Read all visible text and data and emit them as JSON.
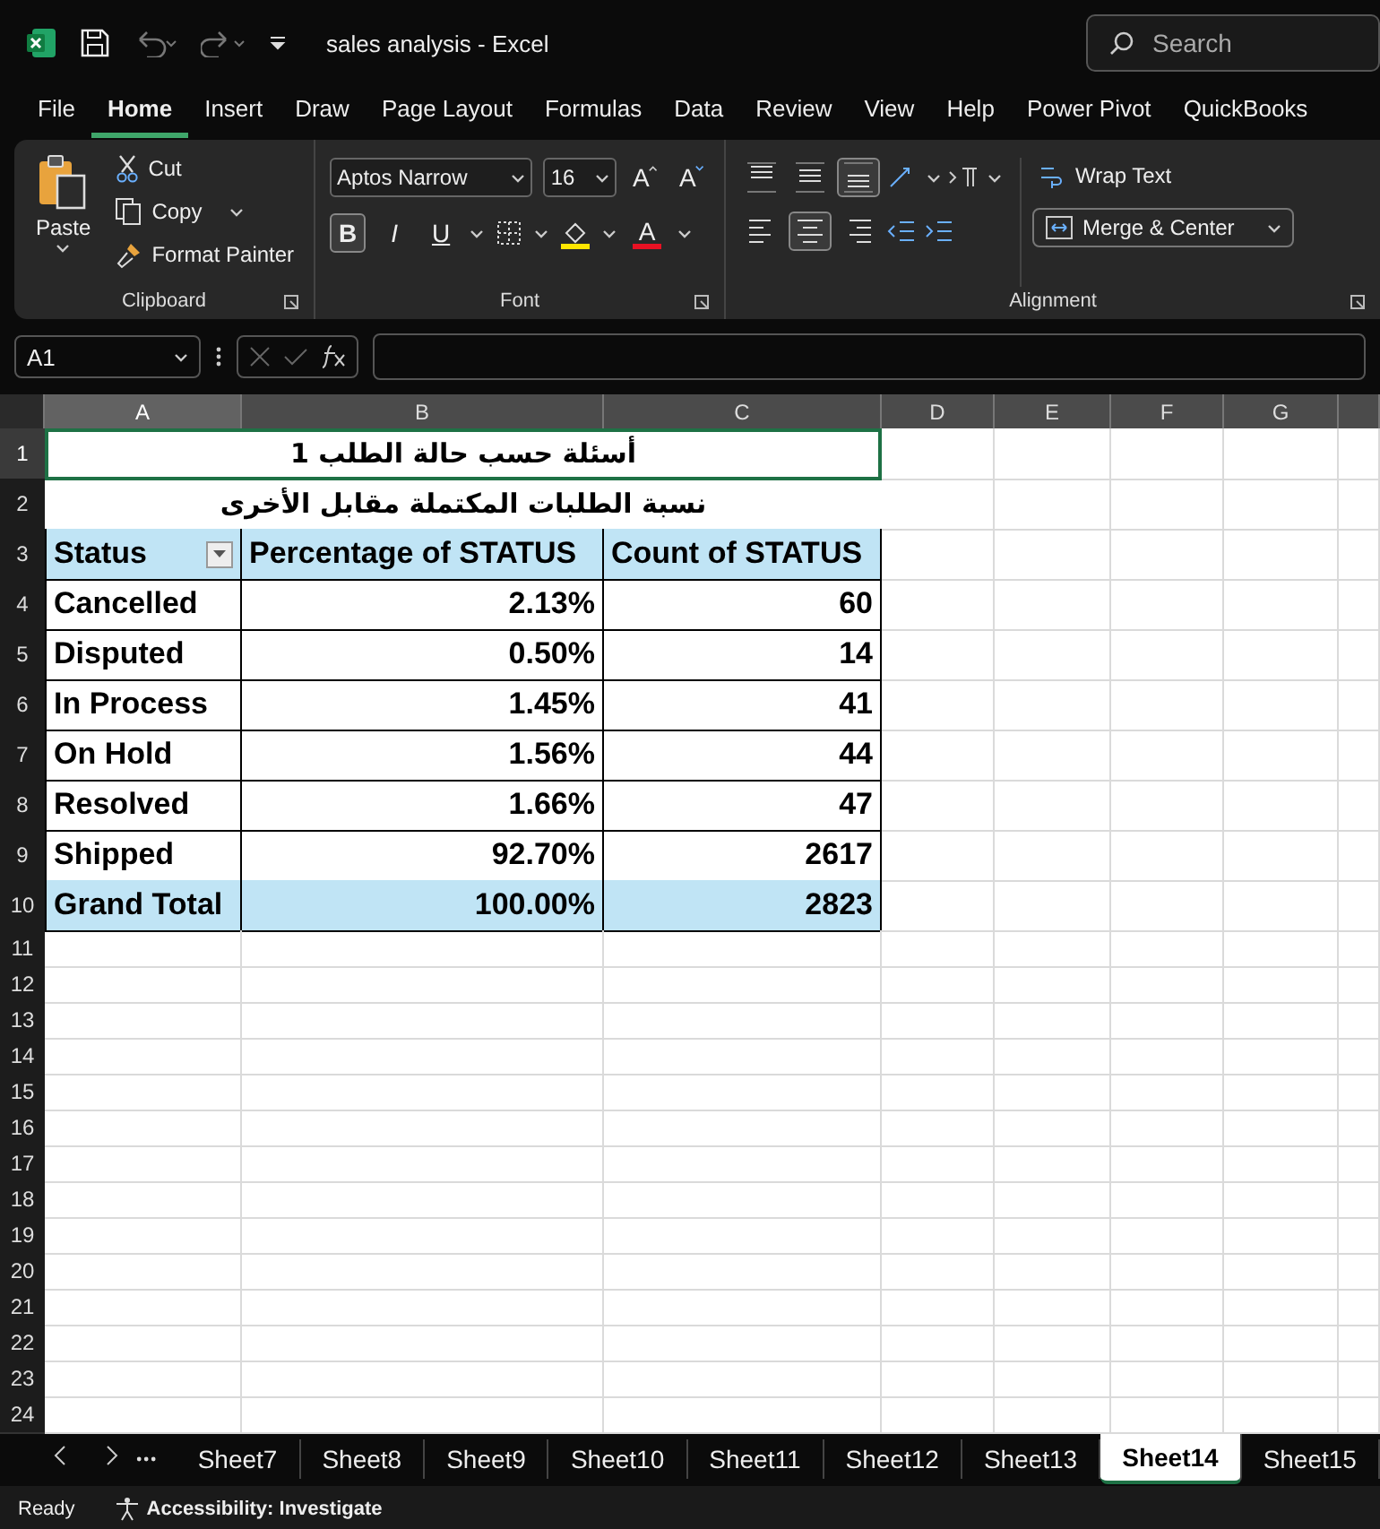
{
  "window": {
    "title": "sales analysis  -  Excel",
    "search_placeholder": "Search"
  },
  "menu_tabs": [
    {
      "label": "File",
      "selected": false
    },
    {
      "label": "Home",
      "selected": true
    },
    {
      "label": "Insert",
      "selected": false
    },
    {
      "label": "Draw",
      "selected": false
    },
    {
      "label": "Page Layout",
      "selected": false
    },
    {
      "label": "Formulas",
      "selected": false
    },
    {
      "label": "Data",
      "selected": false
    },
    {
      "label": "Review",
      "selected": false
    },
    {
      "label": "View",
      "selected": false
    },
    {
      "label": "Help",
      "selected": false
    },
    {
      "label": "Power Pivot",
      "selected": false
    },
    {
      "label": "QuickBooks",
      "selected": false
    }
  ],
  "ribbon": {
    "clipboard": {
      "paste": "Paste",
      "cut": "Cut",
      "copy": "Copy",
      "format_painter": "Format Painter",
      "label": "Clipboard"
    },
    "font": {
      "font_name": "Aptos Narrow",
      "font_size": "16",
      "grow": "A",
      "shrink": "A",
      "label": "Font",
      "format_buttons": [
        {
          "kind": "bold",
          "label": "B",
          "selected": true
        },
        {
          "kind": "italic",
          "label": "I",
          "selected": false
        },
        {
          "kind": "underline",
          "label": "U",
          "selected": false
        }
      ],
      "font_color": "A"
    },
    "alignment": {
      "label": "Alignment",
      "wrap_text": "Wrap Text",
      "merge_center": "Merge & Center",
      "vertical": [
        {
          "kind": "top",
          "selected": false
        },
        {
          "kind": "middle",
          "selected": false
        },
        {
          "kind": "bottom",
          "selected": true
        }
      ],
      "horizontal": [
        {
          "kind": "left",
          "selected": false
        },
        {
          "kind": "center",
          "selected": true
        },
        {
          "kind": "right",
          "selected": false
        }
      ]
    }
  },
  "formula_bar": {
    "name_box": "A1"
  },
  "columns": [
    {
      "label": "A",
      "selected": true
    },
    {
      "label": "B",
      "selected": false
    },
    {
      "label": "C",
      "selected": false
    },
    {
      "label": "D",
      "selected": false
    },
    {
      "label": "E",
      "selected": false
    },
    {
      "label": "F",
      "selected": false
    },
    {
      "label": "G",
      "selected": false
    }
  ],
  "rows": [
    {
      "num": "1",
      "kind": "merged",
      "text": "أسئلة حسب حالة الطلب 1",
      "selected": true
    },
    {
      "num": "2",
      "kind": "merged",
      "text": "نسبة الطلبات المكتملة مقابل الأخرى",
      "selected": false
    },
    {
      "num": "3",
      "kind": "header",
      "cells": [
        "Status",
        "Percentage of STATUS",
        "Count of STATUS"
      ]
    },
    {
      "num": "4",
      "kind": "data",
      "cells": [
        "Cancelled",
        "2.13%",
        "60"
      ]
    },
    {
      "num": "5",
      "kind": "data",
      "cells": [
        "Disputed",
        "0.50%",
        "14"
      ]
    },
    {
      "num": "6",
      "kind": "data",
      "cells": [
        "In Process",
        "1.45%",
        "41"
      ]
    },
    {
      "num": "7",
      "kind": "data",
      "cells": [
        "On Hold",
        "1.56%",
        "44"
      ]
    },
    {
      "num": "8",
      "kind": "data",
      "cells": [
        "Resolved",
        "1.66%",
        "47"
      ]
    },
    {
      "num": "9",
      "kind": "data",
      "cells": [
        "Shipped",
        "92.70%",
        "2617"
      ]
    },
    {
      "num": "10",
      "kind": "total",
      "cells": [
        "Grand Total",
        "100.00%",
        "2823"
      ]
    },
    {
      "num": "11",
      "kind": "empty"
    },
    {
      "num": "12",
      "kind": "empty"
    },
    {
      "num": "13",
      "kind": "empty"
    },
    {
      "num": "14",
      "kind": "empty"
    },
    {
      "num": "15",
      "kind": "empty"
    },
    {
      "num": "16",
      "kind": "empty"
    },
    {
      "num": "17",
      "kind": "empty"
    },
    {
      "num": "18",
      "kind": "empty"
    },
    {
      "num": "19",
      "kind": "empty"
    },
    {
      "num": "20",
      "kind": "empty"
    },
    {
      "num": "21",
      "kind": "empty"
    },
    {
      "num": "22",
      "kind": "empty"
    },
    {
      "num": "23",
      "kind": "empty"
    },
    {
      "num": "24",
      "kind": "empty"
    }
  ],
  "sheet_tabs": [
    {
      "label": "Sheet7",
      "selected": false
    },
    {
      "label": "Sheet8",
      "selected": false
    },
    {
      "label": "Sheet9",
      "selected": false
    },
    {
      "label": "Sheet10",
      "selected": false
    },
    {
      "label": "Sheet11",
      "selected": false
    },
    {
      "label": "Sheet12",
      "selected": false
    },
    {
      "label": "Sheet13",
      "selected": false
    },
    {
      "label": "Sheet14",
      "selected": true
    },
    {
      "label": "Sheet15",
      "selected": false
    }
  ],
  "status_bar": {
    "ready": "Ready",
    "accessibility": "Accessibility: Investigate"
  }
}
